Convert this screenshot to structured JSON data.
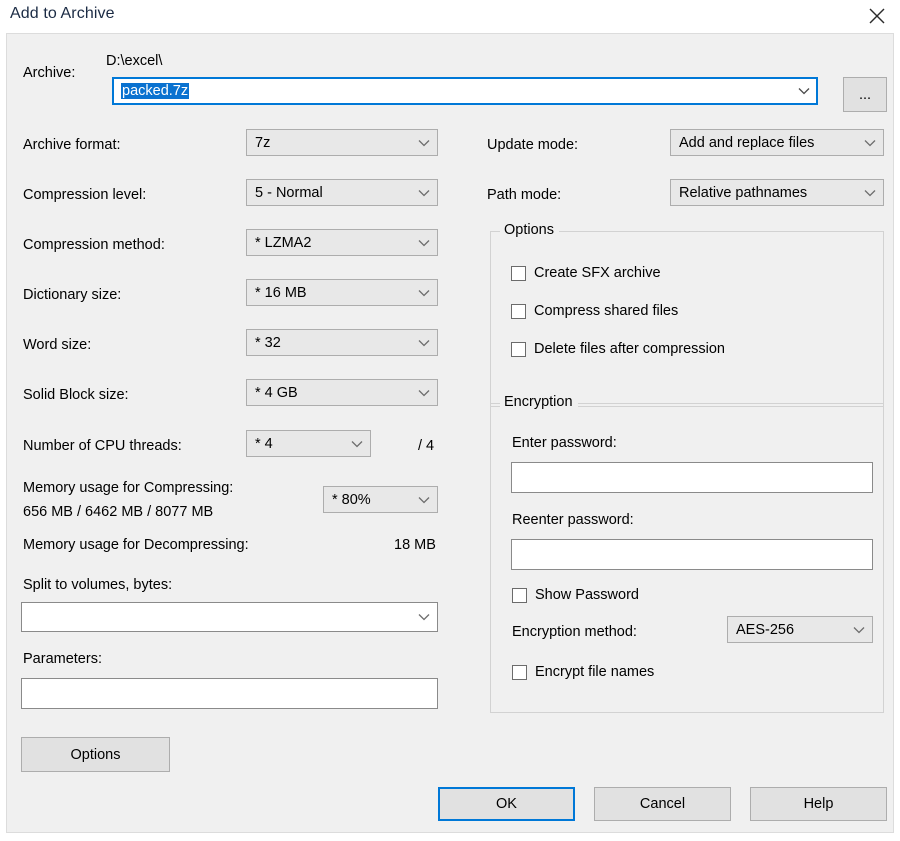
{
  "window": {
    "title": "Add to Archive",
    "close_icon": "close-icon"
  },
  "archive": {
    "label": "Archive:",
    "path": "D:\\excel\\",
    "filename": "packed.7z",
    "browse_label": "...",
    "chevron_icon": "chevron-down-icon"
  },
  "left_column": [
    {
      "label": "Archive format:",
      "value": "7z"
    },
    {
      "label": "Compression level:",
      "value": "5 - Normal"
    },
    {
      "label": "Compression method:",
      "value": "*  LZMA2"
    },
    {
      "label": "Dictionary size:",
      "value": "*  16 MB"
    },
    {
      "label": "Word size:",
      "value": "*  32"
    },
    {
      "label": "Solid Block size:",
      "value": "*  4 GB"
    }
  ],
  "cpu": {
    "label": "Number of CPU threads:",
    "value": "*  4",
    "total": "/ 4"
  },
  "memory": {
    "compress_label": "Memory usage for Compressing:",
    "compress_value": "656 MB / 6462 MB / 8077 MB",
    "percent": "* 80%",
    "decompress_label": "Memory usage for Decompressing:",
    "decompress_value": "18 MB"
  },
  "split": {
    "label": "Split to volumes, bytes:",
    "value": ""
  },
  "parameters": {
    "label": "Parameters:",
    "value": ""
  },
  "update_mode": {
    "label": "Update mode:",
    "value": "Add and replace files"
  },
  "path_mode": {
    "label": "Path mode:",
    "value": "Relative pathnames"
  },
  "options_group": {
    "title": "Options",
    "items": [
      {
        "label": "Create SFX archive",
        "checked": false
      },
      {
        "label": "Compress shared files",
        "checked": false
      },
      {
        "label": "Delete files after compression",
        "checked": false
      }
    ]
  },
  "encryption_group": {
    "title": "Encryption",
    "enter_password_label": "Enter password:",
    "enter_password_value": "",
    "reenter_password_label": "Reenter password:",
    "reenter_password_value": "",
    "show_password_label": "Show Password",
    "show_password_checked": false,
    "method_label": "Encryption method:",
    "method_value": "AES-256",
    "encrypt_names_label": "Encrypt file names",
    "encrypt_names_checked": false
  },
  "buttons": {
    "options": "Options",
    "ok": "OK",
    "cancel": "Cancel",
    "help": "Help"
  },
  "colors": {
    "accent": "#0078d7",
    "selection": "#0a72d0",
    "panel": "#f0f0f0",
    "control": "#e8e8e8"
  }
}
